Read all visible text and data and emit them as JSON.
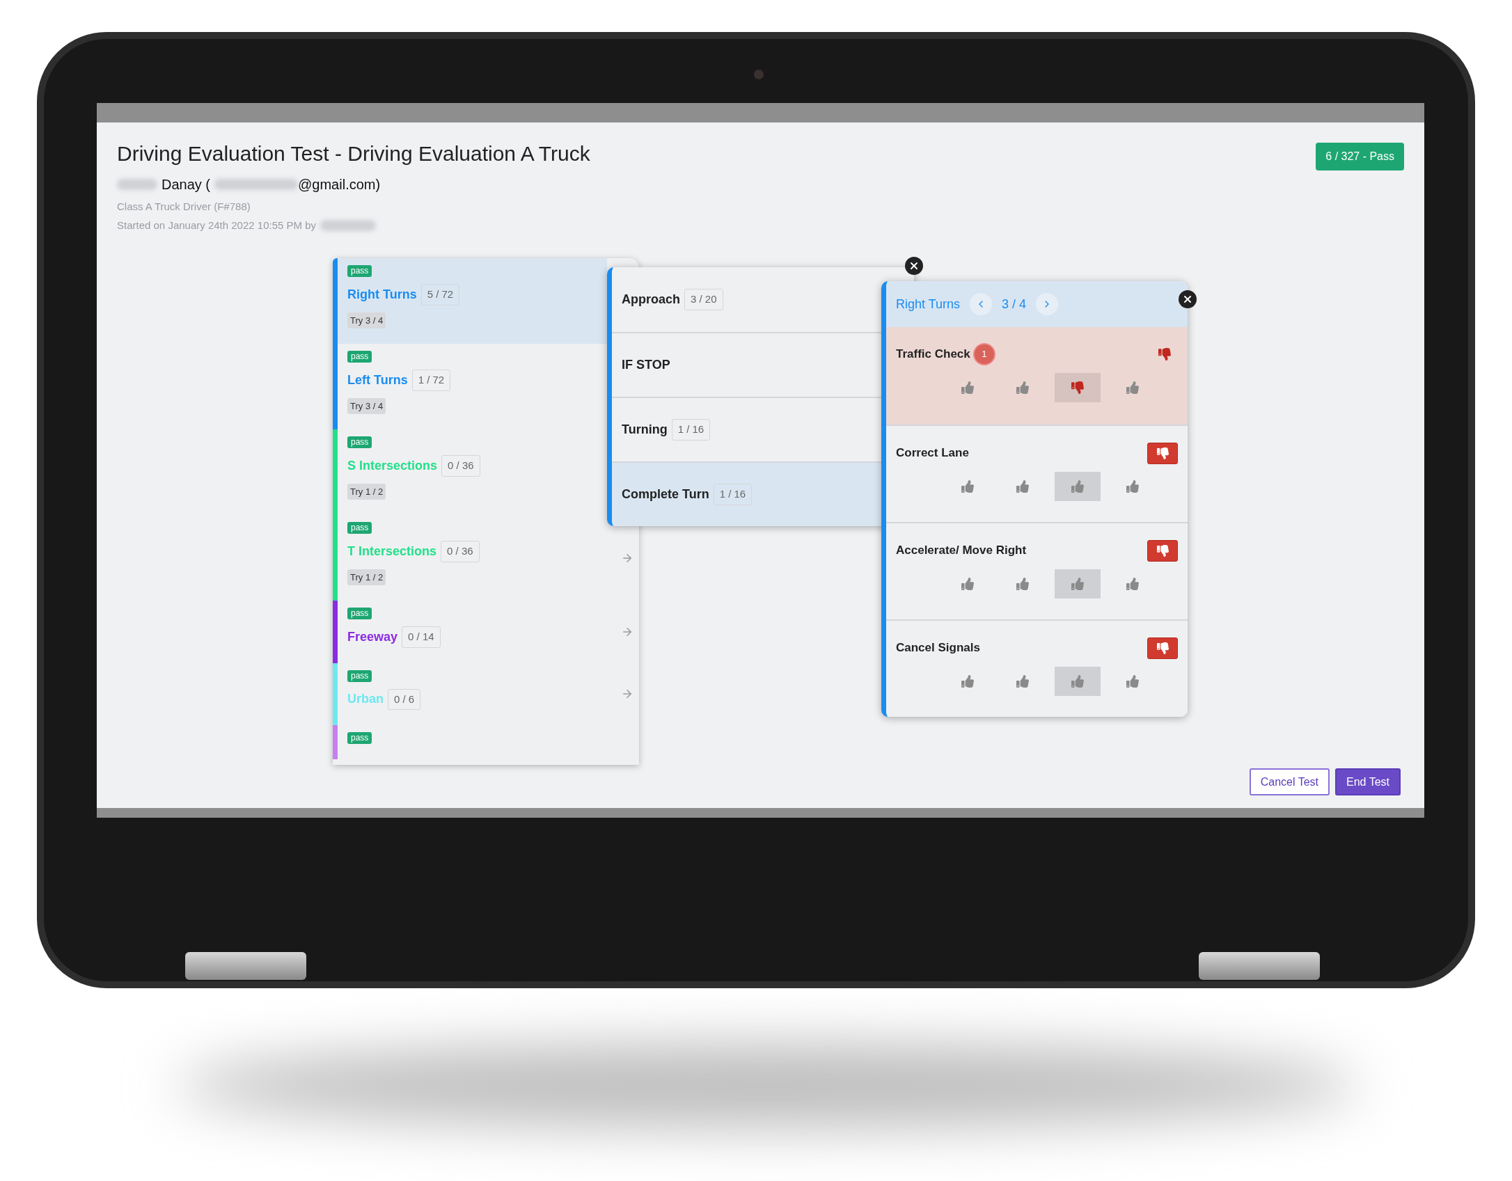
{
  "header": {
    "title": "Driving Evaluation Test - Driving Evaluation A Truck",
    "user_parts": [
      "Danay (",
      "@gmail.com)"
    ],
    "role": "Class A Truck Driver (F#788)",
    "started": "Started on January 24th 2022 10:55 PM by",
    "score_badge": "6 / 327 - Pass"
  },
  "categories": [
    {
      "badge": "pass",
      "name": "Right Turns",
      "count": "5 / 72",
      "tries": "Try 3 / 4",
      "color": "#1a8cf0",
      "selected": true
    },
    {
      "badge": "pass",
      "name": "Left Turns",
      "count": "1 / 72",
      "tries": "Try 3 / 4",
      "color": "#1a8cf0",
      "selected": false
    },
    {
      "badge": "pass",
      "name": "S Intersections",
      "count": "0 / 36",
      "tries": "Try 1 / 2",
      "color": "#22e08a",
      "selected": false
    },
    {
      "badge": "pass",
      "name": "T Intersections",
      "count": "0 / 36",
      "tries": "Try 1 / 2",
      "color": "#22e08a",
      "selected": false,
      "arrow": true
    },
    {
      "badge": "pass",
      "name": "Freeway",
      "count": "0 / 14",
      "color": "#8b2be2",
      "selected": false,
      "arrow": true
    },
    {
      "badge": "pass",
      "name": "Urban",
      "count": "0 / 6",
      "color": "#6ee8f0",
      "selected": false,
      "arrow": true
    },
    {
      "badge": "pass",
      "color": "#c77ef0",
      "selected": false
    }
  ],
  "steps": [
    {
      "name": "Approach",
      "count": "3 / 20",
      "selected": false
    },
    {
      "name": "IF STOP",
      "selected": false
    },
    {
      "name": "Turning",
      "count": "1 / 16",
      "selected": false
    },
    {
      "name": "Complete Turn",
      "count": "1 / 16",
      "selected": true
    }
  ],
  "detail": {
    "title": "Right Turns",
    "page": "3 / 4",
    "items": [
      {
        "label": "Traffic Check",
        "count": "1",
        "flagged": true,
        "ratings": [
          {
            "kind": "up",
            "selected": false
          },
          {
            "kind": "up",
            "selected": false
          },
          {
            "kind": "down",
            "selected": true
          },
          {
            "kind": "up",
            "selected": false
          }
        ]
      },
      {
        "label": "Correct Lane",
        "flagged": false,
        "ratings": [
          {
            "kind": "up",
            "selected": false
          },
          {
            "kind": "up",
            "selected": false
          },
          {
            "kind": "up",
            "selected": true
          },
          {
            "kind": "up",
            "selected": false
          }
        ]
      },
      {
        "label": "Accelerate/ Move Right",
        "flagged": false,
        "ratings": [
          {
            "kind": "up",
            "selected": false
          },
          {
            "kind": "up",
            "selected": false
          },
          {
            "kind": "up",
            "selected": true
          },
          {
            "kind": "up",
            "selected": false
          }
        ]
      },
      {
        "label": "Cancel Signals",
        "flagged": false,
        "ratings": [
          {
            "kind": "up",
            "selected": false
          },
          {
            "kind": "up",
            "selected": false
          },
          {
            "kind": "up",
            "selected": true
          },
          {
            "kind": "up",
            "selected": false
          }
        ]
      }
    ]
  },
  "buttons": [
    {
      "label": "Cancel Test",
      "kind": "outline"
    },
    {
      "label": "End Test",
      "kind": "primary"
    }
  ]
}
